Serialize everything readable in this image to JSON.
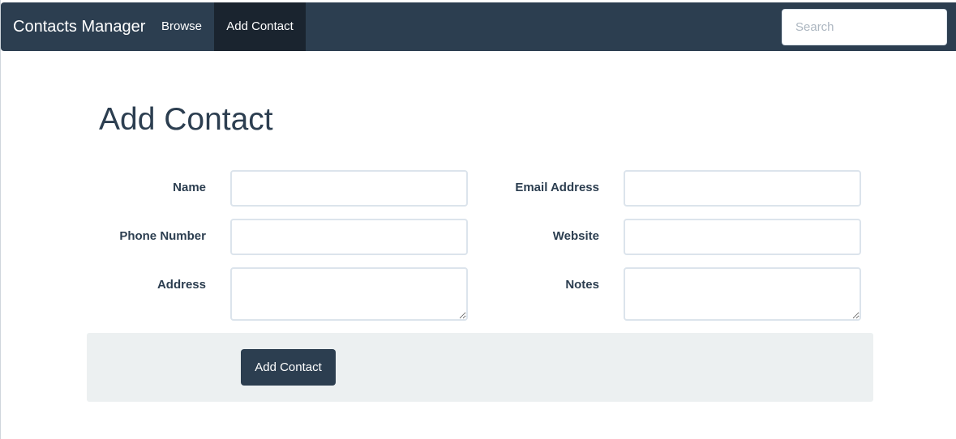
{
  "navbar": {
    "brand": "Contacts Manager",
    "items": [
      {
        "label": "Browse",
        "active": false
      },
      {
        "label": "Add Contact",
        "active": true
      }
    ],
    "search": {
      "placeholder": "Search",
      "value": ""
    },
    "colors": {
      "background": "#2c3e50",
      "active_item": "#1a242f"
    }
  },
  "form": {
    "title": "Add Contact",
    "fields": {
      "name": {
        "label": "Name",
        "value": ""
      },
      "email": {
        "label": "Email Address",
        "value": ""
      },
      "phone": {
        "label": "Phone Number",
        "value": ""
      },
      "website": {
        "label": "Website",
        "value": ""
      },
      "address": {
        "label": "Address",
        "value": ""
      },
      "notes": {
        "label": "Notes",
        "value": ""
      }
    },
    "submit_label": "Add Contact"
  }
}
